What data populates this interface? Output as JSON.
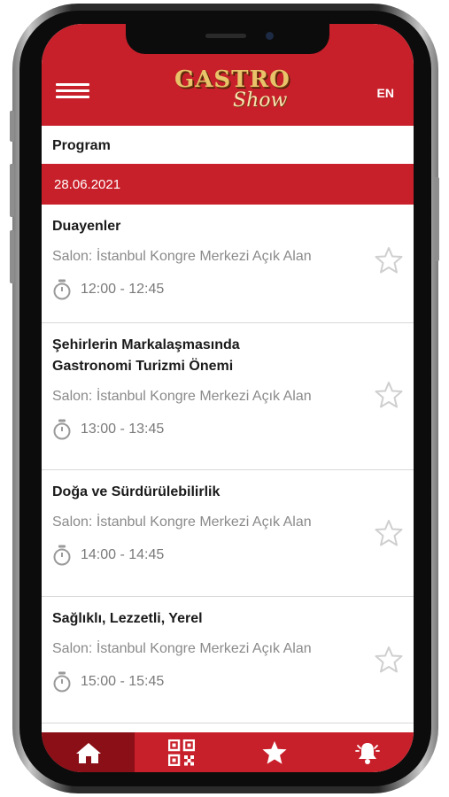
{
  "header": {
    "logo_line1": "GASTRO",
    "logo_line2": "Show",
    "language": "EN"
  },
  "page_title": "Program",
  "date": "28.06.2021",
  "sessions": [
    {
      "title": "Duayenler",
      "salon": "Salon: İstanbul Kongre Merkezi Açık Alan",
      "time": "12:00 - 12:45"
    },
    {
      "title": "Şehirlerin Markalaşmasında Gastronomi Turizmi Önemi",
      "salon": "Salon: İstanbul Kongre Merkezi Açık Alan",
      "time": "13:00 - 13:45"
    },
    {
      "title": "Doğa ve Sürdürülebilirlik",
      "salon": "Salon: İstanbul Kongre Merkezi Açık Alan",
      "time": "14:00 - 14:45"
    },
    {
      "title": "Sağlıklı, Lezzetli, Yerel",
      "salon": "Salon: İstanbul Kongre Merkezi Açık Alan",
      "time": "15:00 - 15:45"
    }
  ],
  "tabs": [
    {
      "icon": "home-icon",
      "active": true
    },
    {
      "icon": "qr-code-icon",
      "active": false
    },
    {
      "icon": "star-icon",
      "active": false
    },
    {
      "icon": "bell-icon",
      "active": false
    }
  ],
  "colors": {
    "accent": "#c8202a",
    "active_tab": "#8b0f17",
    "muted_text": "#8a8a8a"
  }
}
